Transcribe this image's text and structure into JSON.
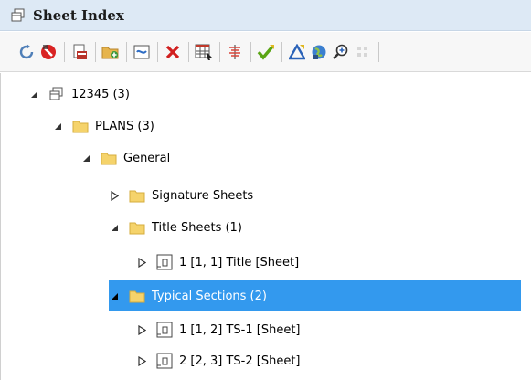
{
  "panel": {
    "title": "Sheet Index",
    "title_icon": "sheet-index-icon"
  },
  "toolbar": {
    "buttons": [
      {
        "name": "refresh-icon"
      },
      {
        "name": "no-entry-icon"
      },
      {
        "name": "export-sheet-icon"
      },
      {
        "name": "add-folder-icon"
      },
      {
        "name": "link-icon"
      },
      {
        "name": "delete-icon"
      },
      {
        "name": "sheet-table-icon"
      },
      {
        "name": "rename-icon"
      },
      {
        "name": "checkmark-icon"
      },
      {
        "name": "triangle-icon"
      },
      {
        "name": "globe-icon"
      },
      {
        "name": "zoom-icon"
      },
      {
        "name": "grid-icon"
      }
    ]
  },
  "tree": {
    "nodes": [
      {
        "label": "12345 (3)",
        "level": 0,
        "icon": "sheet-index-icon",
        "expanded": true
      },
      {
        "label": "PLANS (3)",
        "level": 1,
        "icon": "folder-icon",
        "expanded": true
      },
      {
        "label": "General",
        "level": 2,
        "icon": "folder-icon",
        "expanded": true
      },
      {
        "label": "Signature Sheets",
        "level": 3,
        "icon": "folder-icon",
        "expanded": false
      },
      {
        "label": "Title Sheets (1)",
        "level": 3,
        "icon": "folder-icon",
        "expanded": true
      },
      {
        "label": "1 [1, 1] Title [Sheet]",
        "level": 4,
        "icon": "sheet-icon",
        "expanded": false
      },
      {
        "label": "Typical Sections (2)",
        "level": 3,
        "icon": "folder-icon",
        "expanded": true,
        "selected": true
      },
      {
        "label": "1 [1, 2] TS-1 [Sheet]",
        "level": 4,
        "icon": "sheet-icon",
        "expanded": false
      },
      {
        "label": "2 [2, 3] TS-2 [Sheet]",
        "level": 4,
        "icon": "sheet-icon",
        "expanded": false
      }
    ]
  },
  "colors": {
    "selection": "#3399ee",
    "titlebar": "#dde9f5",
    "folder": "#f5d36b"
  }
}
